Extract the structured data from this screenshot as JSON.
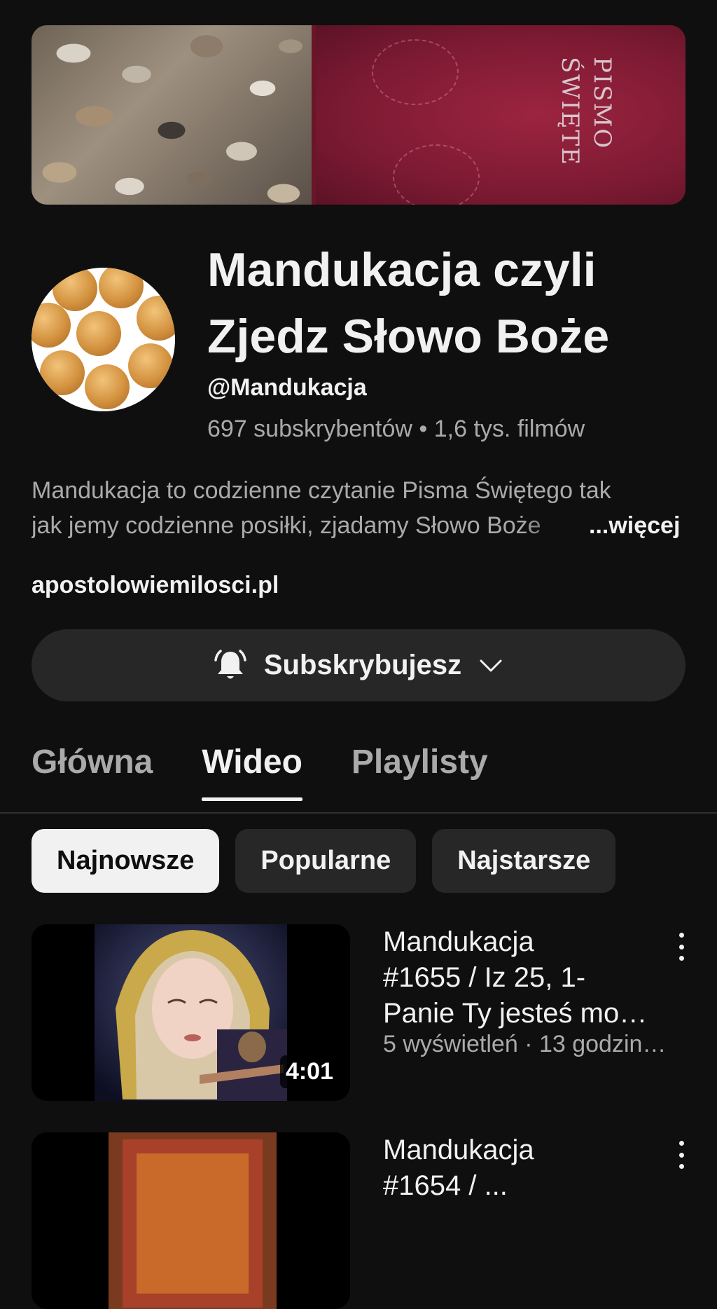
{
  "banner": {
    "cover_title_line1": "PISMO",
    "cover_title_line2": "ŚWIĘTE"
  },
  "channel": {
    "name": "Mandukacja czyli Zjedz Słowo Boże",
    "handle": "@Mandukacja",
    "subscribers": "697 subskrybentów",
    "separator": "•",
    "video_count": "1,6 tys. filmów",
    "description_line1": "Mandukacja to codzienne czytanie Pisma Świętego tak",
    "description_line2": "jak jemy codzienne posiłki, zjadamy Słowo Boże",
    "more_label": "...więcej",
    "website": "apostolowiemilosci.pl"
  },
  "subscribe": {
    "label": "Subskrybujesz",
    "icon": "bell-icon",
    "dropdown_icon": "chevron-down-icon"
  },
  "tabs": [
    {
      "label": "Główna",
      "active": false
    },
    {
      "label": "Wideo",
      "active": true
    },
    {
      "label": "Playlisty",
      "active": false
    }
  ],
  "chips": [
    {
      "label": "Najnowsze",
      "selected": true
    },
    {
      "label": "Popularne",
      "selected": false
    },
    {
      "label": "Najstarsze",
      "selected": false
    }
  ],
  "videos": [
    {
      "title": "Mandukacja #1655 / Iz 25, 1- Panie Ty jesteś mo…",
      "title_line1": "Mandukacja",
      "title_line2": "#1655 / Iz 25, 1-",
      "title_line3": "Panie Ty jesteś mo…",
      "meta": "5 wyświetleń · 13 godzin…",
      "duration": "4:01"
    },
    {
      "title_line1": "Mandukacja",
      "title_line2": "#1654 / ..."
    }
  ],
  "colors": {
    "background": "#0f0f0f",
    "surface": "#272727",
    "text_primary": "#f1f1f1",
    "text_secondary": "#aaaaaa"
  }
}
